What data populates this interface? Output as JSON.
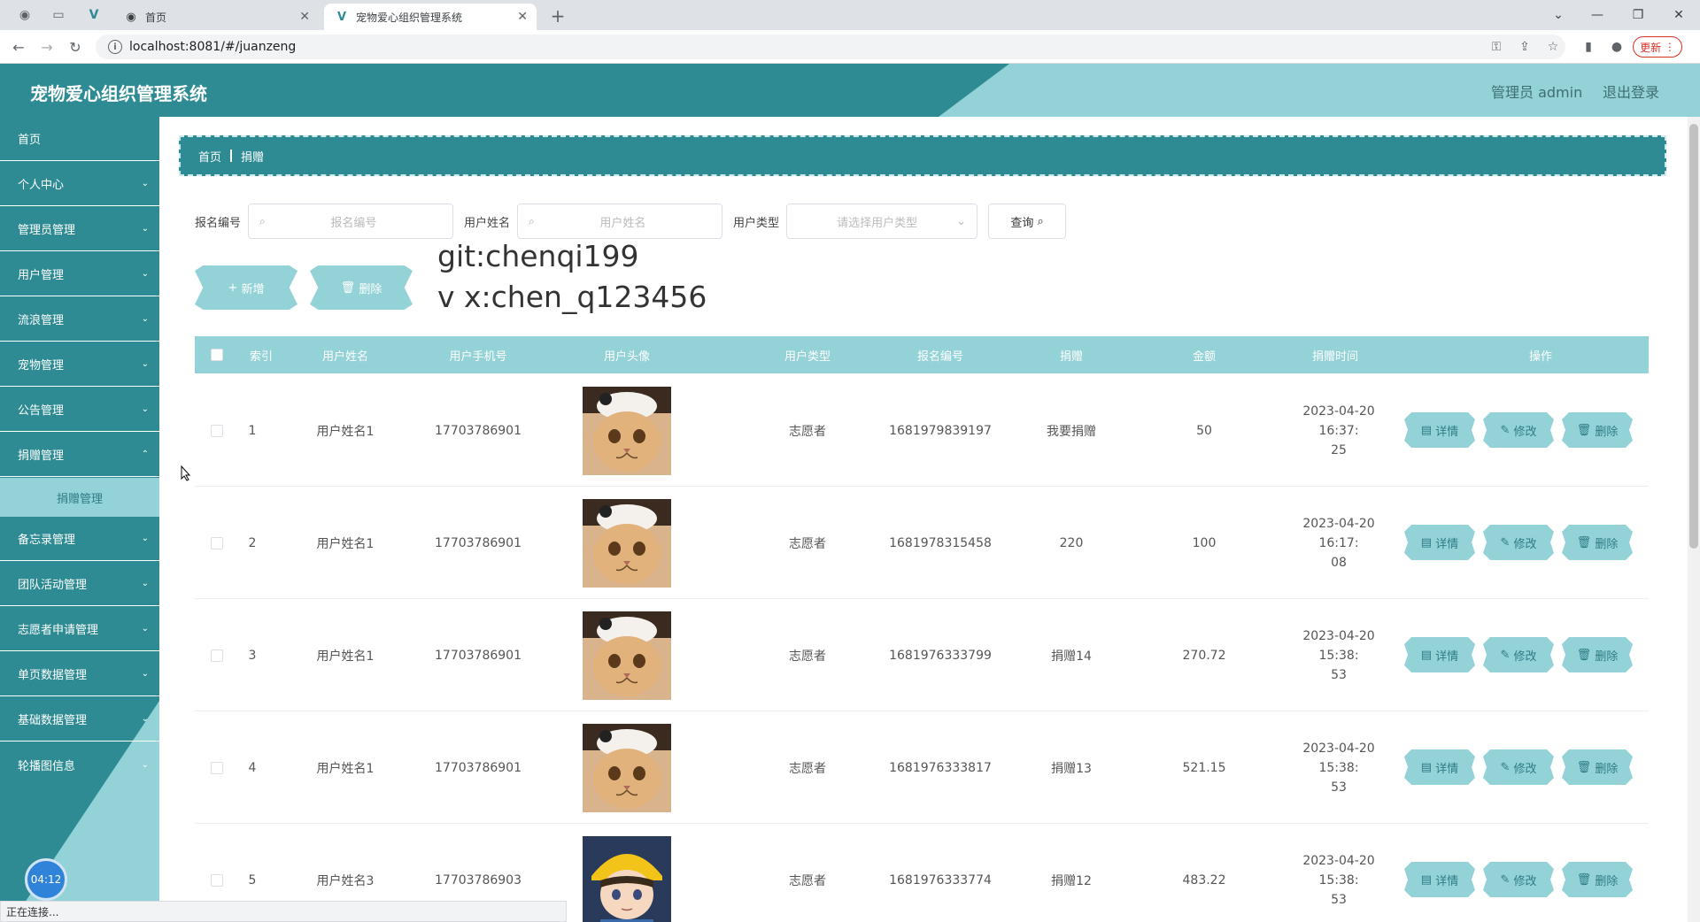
{
  "browser": {
    "tabs": [
      {
        "title": "首页",
        "active": false
      },
      {
        "title": "宠物爱心组织管理系统",
        "active": true
      }
    ],
    "url": "localhost:8081/#/juanzeng",
    "update_label": "更新",
    "status_text": "正在连接..."
  },
  "header": {
    "title": "宠物爱心组织管理系统",
    "user_label": "管理员 admin",
    "logout_label": "退出登录"
  },
  "sidebar": {
    "items": [
      {
        "label": "首页",
        "has_children": false
      },
      {
        "label": "个人中心",
        "has_children": true
      },
      {
        "label": "管理员管理",
        "has_children": true
      },
      {
        "label": "用户管理",
        "has_children": true
      },
      {
        "label": "流浪管理",
        "has_children": true
      },
      {
        "label": "宠物管理",
        "has_children": true
      },
      {
        "label": "公告管理",
        "has_children": true
      },
      {
        "label": "捐赠管理",
        "has_children": true,
        "expanded": true
      },
      {
        "label": "备忘录管理",
        "has_children": true
      },
      {
        "label": "团队活动管理",
        "has_children": true
      },
      {
        "label": "志愿者申请管理",
        "has_children": true
      },
      {
        "label": "单页数据管理",
        "has_children": true
      },
      {
        "label": "基础数据管理",
        "has_children": true
      },
      {
        "label": "轮播图信息",
        "has_children": true
      }
    ],
    "sub_item": "捐赠管理",
    "time_badge": "04:12"
  },
  "breadcrumb": {
    "home": "首页",
    "current": "捐赠"
  },
  "search": {
    "label_report_no": "报名编号",
    "placeholder_report_no": "报名编号",
    "label_user_name": "用户姓名",
    "placeholder_user_name": "用户姓名",
    "label_user_type": "用户类型",
    "placeholder_user_type": "请选择用户类型",
    "query_label": "查询"
  },
  "actions": {
    "add_label": "新增",
    "delete_label": "删除"
  },
  "overlay": {
    "line1": "git:chenqi199",
    "line2": "v x:chen_q123456"
  },
  "table": {
    "headers": [
      "索引",
      "用户姓名",
      "用户手机号",
      "用户头像",
      "用户类型",
      "报名编号",
      "捐赠",
      "金额",
      "捐赠时间",
      "操作"
    ],
    "op_labels": {
      "detail": "详情",
      "edit": "修改",
      "delete": "删除"
    },
    "rows": [
      {
        "index": "1",
        "name": "用户姓名1",
        "phone": "17703786901",
        "avatar": "cat",
        "type": "志愿者",
        "report_no": "1681979839197",
        "donation": "我要捐赠",
        "amount": "50",
        "time1": "2023-04-20 16:37:",
        "time2": "25"
      },
      {
        "index": "2",
        "name": "用户姓名1",
        "phone": "17703786901",
        "avatar": "cat",
        "type": "志愿者",
        "report_no": "1681978315458",
        "donation": "220",
        "amount": "100",
        "time1": "2023-04-20 16:17:",
        "time2": "08"
      },
      {
        "index": "3",
        "name": "用户姓名1",
        "phone": "17703786901",
        "avatar": "cat",
        "type": "志愿者",
        "report_no": "1681976333799",
        "donation": "捐赠14",
        "amount": "270.72",
        "time1": "2023-04-20 15:38:",
        "time2": "53"
      },
      {
        "index": "4",
        "name": "用户姓名1",
        "phone": "17703786901",
        "avatar": "cat",
        "type": "志愿者",
        "report_no": "1681976333817",
        "donation": "捐赠13",
        "amount": "521.15",
        "time1": "2023-04-20 15:38:",
        "time2": "53"
      },
      {
        "index": "5",
        "name": "用户姓名3",
        "phone": "17703786903",
        "avatar": "boy",
        "type": "志愿者",
        "report_no": "1681976333774",
        "donation": "捐赠12",
        "amount": "483.22",
        "time1": "2023-04-20 15:38:",
        "time2": "53"
      }
    ]
  },
  "colors": {
    "primary": "#2e8b93",
    "light": "#93d2d7"
  }
}
